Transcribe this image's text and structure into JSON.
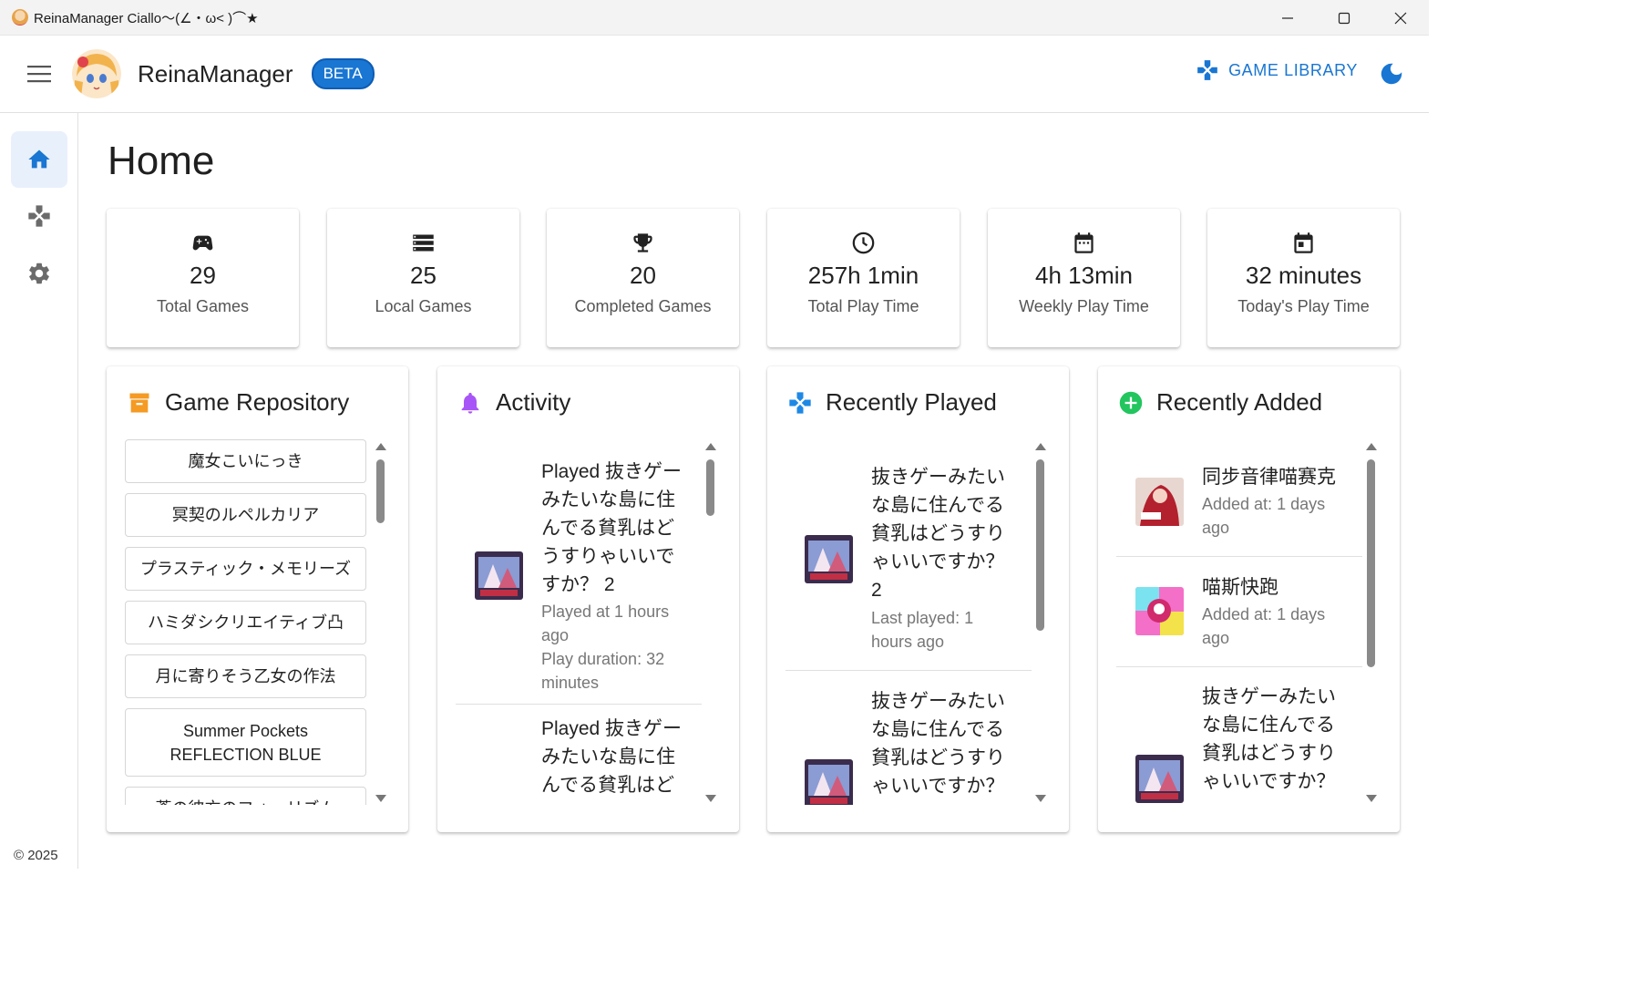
{
  "window": {
    "title": "ReinaManager Ciallo～(∠・ω< )⌒★"
  },
  "appbar": {
    "name": "ReinaManager",
    "badge": "BETA",
    "library_label": "GAME LIBRARY"
  },
  "page": {
    "title": "Home",
    "copyright": "© 2025"
  },
  "stats": [
    {
      "icon": "gamepad-icon",
      "value": "29",
      "label": "Total Games"
    },
    {
      "icon": "list-icon",
      "value": "25",
      "label": "Local Games"
    },
    {
      "icon": "trophy-icon",
      "value": "20",
      "label": "Completed Games"
    },
    {
      "icon": "clock-icon",
      "value": "257h 1min",
      "label": "Total Play Time"
    },
    {
      "icon": "calendar-icon",
      "value": "4h 13min",
      "label": "Weekly Play Time"
    },
    {
      "icon": "calendar-today-icon",
      "value": "32 minutes",
      "label": "Today's Play Time"
    }
  ],
  "repository": {
    "title": "Game Repository",
    "items": [
      "魔女こいにっき",
      "冥契のルペルカリア",
      "プラスティック・メモリーズ",
      "ハミダシクリエイティブ凸",
      "月に寄りそう乙女の作法",
      "Summer Pockets\nREFLECTION BLUE",
      "蒼の彼方のフォーリズム"
    ]
  },
  "activity": {
    "title": "Activity",
    "items": [
      {
        "title": "Played 抜きゲーみたいな島に住んでる貧乳はどうすりゃいいですか？ 2",
        "time": "Played at 1 hours ago",
        "duration": "Play duration: 32 minutes"
      },
      {
        "title": "Played 抜きゲーみたいな島に住んでる貧乳はど"
      }
    ]
  },
  "recently_played": {
    "title": "Recently Played",
    "items": [
      {
        "title": "抜きゲーみたいな島に住んでる貧乳はどうすりゃいいですか？ 2",
        "sub": "Last played: 1 hours ago"
      },
      {
        "title": "抜きゲーみたいな島に住んでる貧乳はどうすりゃいいですか？"
      }
    ]
  },
  "recently_added": {
    "title": "Recently Added",
    "items": [
      {
        "title": "同步音律喵赛克",
        "sub": "Added at: 1 days ago"
      },
      {
        "title": "喵斯快跑",
        "sub": "Added at: 1 days ago"
      },
      {
        "title": "抜きゲーみたいな島に住んでる貧乳はどうすりゃいいですか？"
      }
    ]
  },
  "colors": {
    "primary": "#1976d2",
    "repo_icon": "#f59a23",
    "activity_icon": "#a855f7",
    "recent_icon": "#1e88e5",
    "added_icon": "#22c55e"
  }
}
